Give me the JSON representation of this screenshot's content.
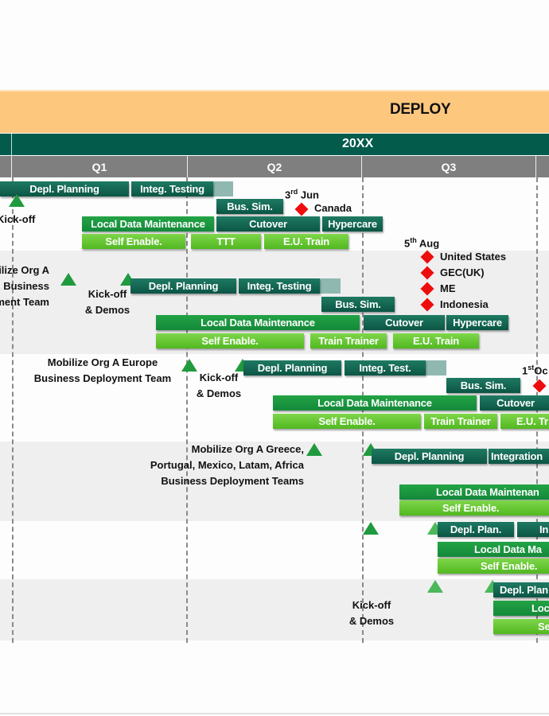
{
  "phase": {
    "title": "DEPLOY",
    "color": "#fdc77d"
  },
  "timeline": {
    "year": "20XX",
    "quarters": [
      "Q1",
      "Q2",
      "Q3"
    ],
    "colors": {
      "year_bar": "#035b4c",
      "quarter_bar": "#7f7f7f"
    }
  },
  "colors": {
    "dark_task": "#0b5545",
    "mid_task": "#14893a",
    "light_task": "#51b820",
    "milestone_triangle": "#1f9a3e",
    "milestone_diamond": "#ee0d0d"
  },
  "rows": [
    {
      "team_label": "",
      "milestones": [
        {
          "label": "Kick-off"
        }
      ],
      "tasks": {
        "depl_planning": "Depl. Planning",
        "integ_testing": "Integ. Testing",
        "bus_sim": "Bus. Sim.",
        "local_data": "Local Data Maintenance",
        "cutover": "Cutover",
        "hypercare": "Hypercare",
        "self_enable": "Self Enable.",
        "ttt": "TTT",
        "eu_train": "E.U. Train"
      },
      "golive": {
        "date_day": "3",
        "date_suffix": "rd",
        "date_month": "Jun",
        "countries": [
          "Canada"
        ]
      }
    },
    {
      "team_label_lines": [
        "ilize Org A",
        "E  Business",
        "ment Team"
      ],
      "milestones": [
        {
          "label_lines": [
            "Kick-off",
            "& Demos"
          ]
        }
      ],
      "tasks": {
        "depl_planning": "Depl. Planning",
        "integ_testing": "Integ. Testing",
        "bus_sim": "Bus. Sim.",
        "local_data": "Local Data Maintenance",
        "cutover": "Cutover",
        "hypercare": "Hypercare",
        "self_enable": "Self Enable.",
        "train_trainer": "Train Trainer",
        "eu_train": "E.U. Train"
      },
      "golive": {
        "date_day": "5",
        "date_suffix": "th",
        "date_month": "Aug",
        "countries": [
          "United States",
          "GEC(UK)",
          "ME",
          "Indonesia"
        ]
      }
    },
    {
      "team_label_lines": [
        "Mobilize Org A Europe",
        "Business Deployment Team"
      ],
      "milestones": [
        {
          "label_lines": [
            "Kick-off",
            "& Demos"
          ]
        }
      ],
      "tasks": {
        "depl_planning": "Depl. Planning",
        "integ_test": "Integ. Test.",
        "bus_sim": "Bus. Sim.",
        "local_data": "Local Data Maintenance",
        "cutover": "Cutover",
        "self_enable": "Self Enable.",
        "train_trainer": "Train Trainer",
        "eu_train": "E.U. Tr"
      },
      "golive": {
        "date_day": "1",
        "date_suffix": "st",
        "date_month": "Oc"
      }
    },
    {
      "team_label_lines": [
        "Mobilize Org A Greece,",
        "Portugal, Mexico, Latam, Africa",
        "Business Deployment Teams"
      ],
      "tasks": {
        "depl_planning": "Depl. Planning",
        "integration": "Integration",
        "local_data": "Local Data Maintenan",
        "self_enable": "Self Enable."
      }
    },
    {
      "tasks": {
        "depl_plan": "Depl. Plan.",
        "integ": "In",
        "local_data": "Local Data Ma",
        "self_enable": "Self Enable."
      }
    },
    {
      "milestones": [
        {
          "label_lines": [
            "Kick-off",
            "& Demos"
          ]
        }
      ],
      "tasks": {
        "depl_plan": "Depl. Plan",
        "local_data": "Loc",
        "self_enable": "Se"
      }
    }
  ]
}
